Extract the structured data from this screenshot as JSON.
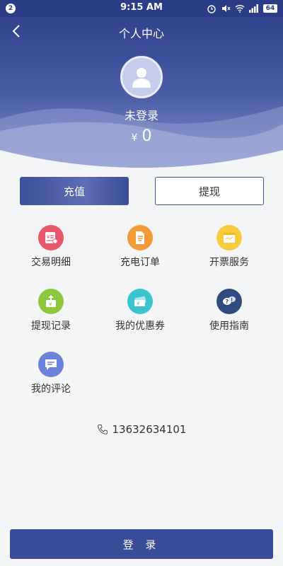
{
  "status_bar": {
    "notification_count": "2",
    "time": "9:15 AM",
    "battery": "64"
  },
  "header": {
    "title": "个人中心",
    "login_status": "未登录",
    "currency_symbol": "¥",
    "balance": "0"
  },
  "actions": {
    "recharge_label": "充值",
    "withdraw_label": "提现"
  },
  "menu": [
    {
      "label": "交易明细",
      "icon": "transaction-detail-icon",
      "color": "#e9576b"
    },
    {
      "label": "充电订单",
      "icon": "charging-order-icon",
      "color": "#f39a3b"
    },
    {
      "label": "开票服务",
      "icon": "invoice-service-icon",
      "color": "#f7cc3c"
    },
    {
      "label": "提现记录",
      "icon": "withdraw-record-icon",
      "color": "#8cc83e"
    },
    {
      "label": "我的优惠券",
      "icon": "coupon-icon",
      "color": "#3bc3cf"
    },
    {
      "label": "使用指南",
      "icon": "guide-icon",
      "color": "#2f4b7f"
    },
    {
      "label": "我的评论",
      "icon": "comment-icon",
      "color": "#6b82db"
    }
  ],
  "contact": {
    "phone": "13632634101"
  },
  "footer": {
    "login_label": "登 录"
  },
  "colors": {
    "primary": "#3a4c98",
    "header_top": "#2b3c86",
    "background": "#f4f5f7"
  }
}
